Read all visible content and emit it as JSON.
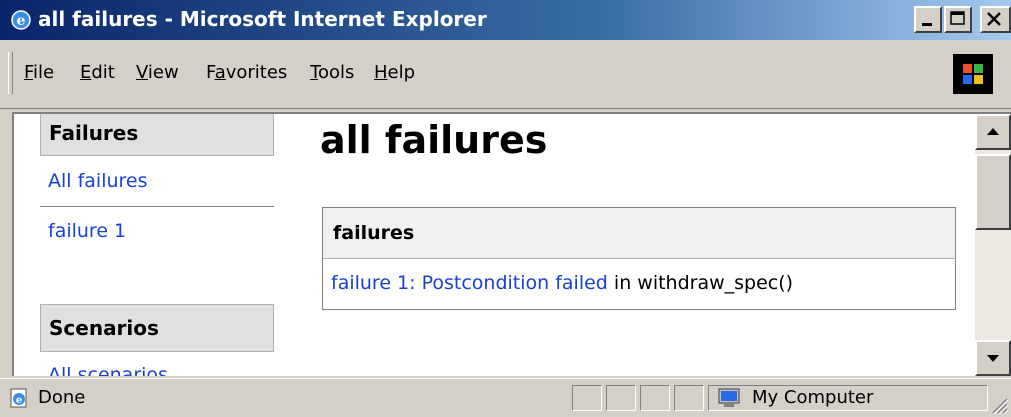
{
  "window": {
    "title": "all failures - Microsoft Internet Explorer",
    "controls": {
      "minimize": "minimize",
      "maximize": "maximize",
      "close": "close"
    }
  },
  "menu": {
    "items": [
      {
        "label": "File",
        "accel": "F",
        "rest": "ile"
      },
      {
        "label": "Edit",
        "accel": "E",
        "rest": "dit"
      },
      {
        "label": "View",
        "accel": "V",
        "rest": "iew"
      },
      {
        "label": "Favorites",
        "pre": "F",
        "accel": "a",
        "rest": "vorites"
      },
      {
        "label": "Tools",
        "accel": "T",
        "rest": "ools"
      },
      {
        "label": "Help",
        "accel": "H",
        "rest": "elp"
      }
    ]
  },
  "sidebar": {
    "failures_heading": "Failures",
    "links": [
      "All failures",
      "failure 1"
    ],
    "scenarios_heading": "Scenarios",
    "scenarios_link_partial": "All scenarios"
  },
  "main": {
    "title": "all failures",
    "table": {
      "header": "failures",
      "rows": [
        {
          "link": "failure 1: Postcondition failed",
          "rest": " in withdraw_spec()"
        }
      ]
    }
  },
  "status": {
    "text": "Done",
    "zone": "My Computer"
  },
  "colors": {
    "link": "#1a3fd6",
    "titlebar_start": "#0a246a",
    "titlebar_end": "#a6caf0"
  }
}
